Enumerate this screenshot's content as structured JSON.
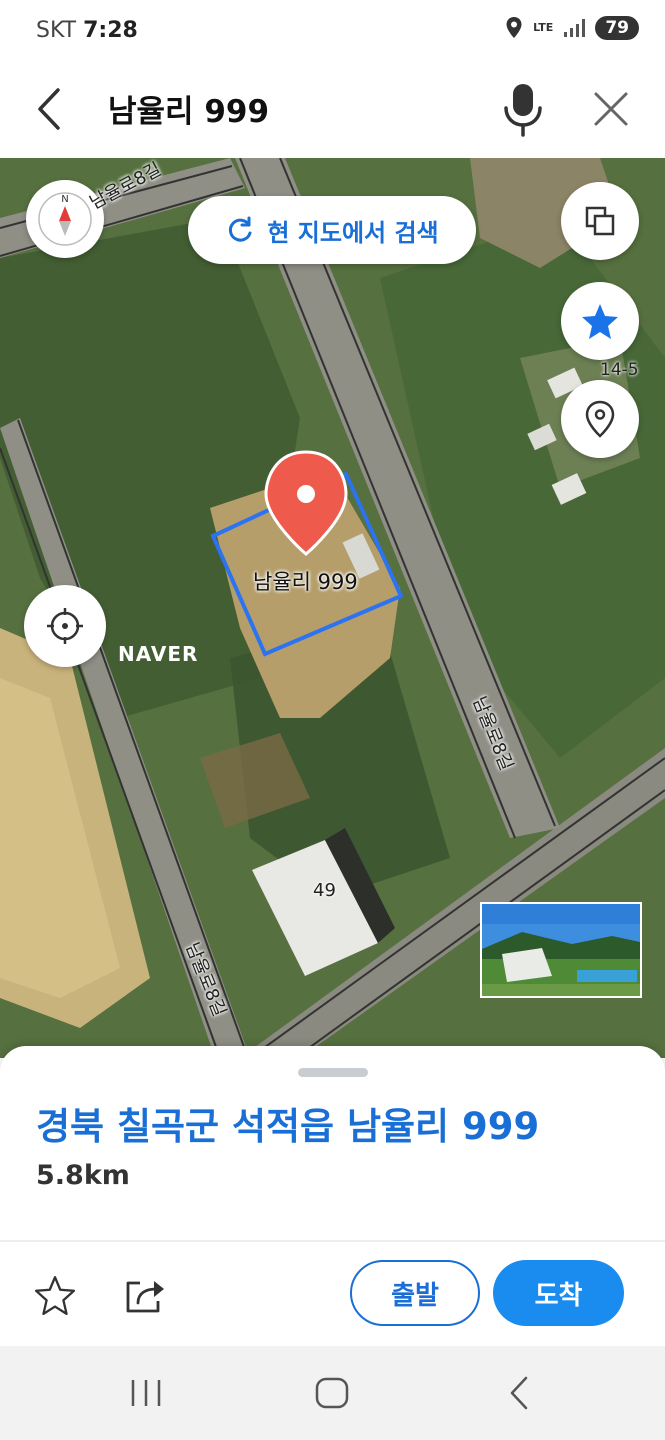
{
  "status_bar": {
    "carrier": "SKT",
    "time": "7:28",
    "network": "LTE",
    "battery": "79"
  },
  "search": {
    "query": "남율리 999"
  },
  "map": {
    "research_label": "현 지도에서 검색",
    "marker_label": "남율리 999",
    "building_number": "49",
    "nearby_label": "14-5",
    "logo": "NAVER",
    "road_labels": [
      "남율로8길",
      "남율로8길",
      "남율로8길"
    ]
  },
  "place": {
    "address": "경북 칠곡군 석적읍 남율리 999",
    "distance": "5.8km",
    "start_label": "출발",
    "arrive_label": "도착"
  },
  "icons": {
    "back": "back-arrow-icon",
    "mic": "microphone-icon",
    "close": "close-icon",
    "compass": "compass-icon",
    "refresh": "refresh-icon",
    "layers": "layers-icon",
    "favorite": "star-icon",
    "location": "location-pin-icon",
    "gps": "crosshair-icon",
    "share": "share-icon"
  },
  "colors": {
    "accent": "#1a6fd6",
    "marker": "#ee5a4c",
    "primary_button": "#1a8cf0"
  }
}
